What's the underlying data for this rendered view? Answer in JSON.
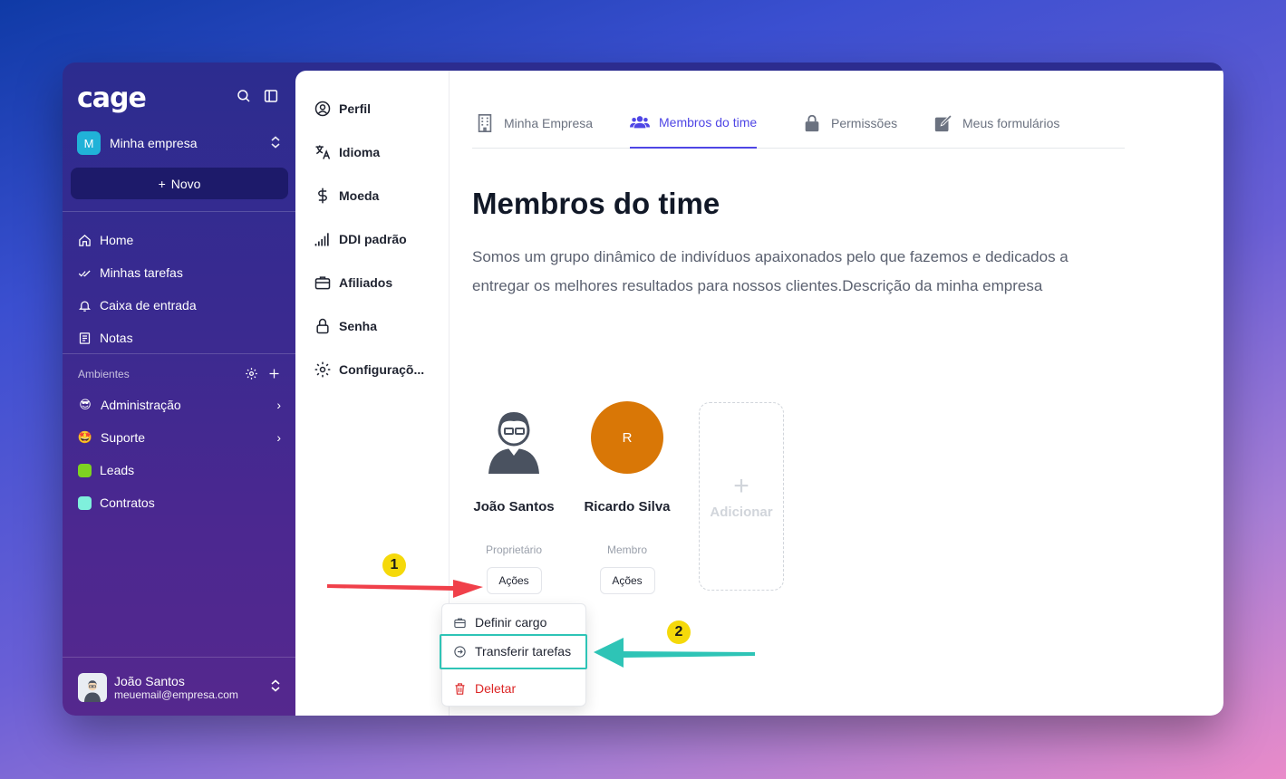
{
  "app": {
    "logo": "cage"
  },
  "workspace": {
    "badge": "M",
    "name": "Minha empresa"
  },
  "new_button": {
    "label": "Novo"
  },
  "nav": [
    {
      "label": "Home",
      "icon": "home-icon"
    },
    {
      "label": "Minhas tarefas",
      "icon": "check-double-icon"
    },
    {
      "label": "Caixa de entrada",
      "icon": "bell-icon"
    },
    {
      "label": "Notas",
      "icon": "notes-icon"
    }
  ],
  "environments": {
    "header": "Ambientes",
    "items": [
      {
        "label": "Administração",
        "emoji": "😎",
        "has_chevron": true
      },
      {
        "label": "Suporte",
        "emoji": "🤩",
        "has_chevron": true
      },
      {
        "label": "Leads",
        "color": "#7ed321"
      },
      {
        "label": "Contratos",
        "color": "#7ff0dc"
      }
    ]
  },
  "user": {
    "name": "João Santos",
    "email": "meuemail@empresa.com"
  },
  "settings_nav": [
    {
      "label": "Perfil",
      "icon": "user-circle-icon"
    },
    {
      "label": "Idioma",
      "icon": "translate-icon"
    },
    {
      "label": "Moeda",
      "icon": "dollar-icon"
    },
    {
      "label": "DDI padrão",
      "icon": "signal-icon"
    },
    {
      "label": "Afiliados",
      "icon": "briefcase-icon"
    },
    {
      "label": "Senha",
      "icon": "lock-icon"
    },
    {
      "label": "Configuraçõ...",
      "icon": "gear-icon"
    }
  ],
  "tabs": [
    {
      "label": "Minha Empresa",
      "icon": "building-icon",
      "active": false
    },
    {
      "label": "Membros do time",
      "icon": "users-icon",
      "active": true
    },
    {
      "label": "Permissões",
      "icon": "lock-icon",
      "active": false
    },
    {
      "label": "Meus formulários",
      "icon": "edit-icon",
      "active": false
    }
  ],
  "page": {
    "title": "Membros do time",
    "description": "Somos um grupo dinâmico de indivíduos apaixonados pelo que fazemos e dedicados a entregar os melhores resultados para nossos clientes.Descrição da minha empresa"
  },
  "members": [
    {
      "name": "João Santos",
      "role": "Proprietário",
      "action": "Ações",
      "avatar": "person-avatar"
    },
    {
      "name": "Ricardo Silva",
      "role": "Membro",
      "action": "Ações",
      "initial": "R",
      "color": "#d97706"
    }
  ],
  "add_card": {
    "label": "Adicionar"
  },
  "dropdown": [
    {
      "label": "Definir cargo",
      "icon": "briefcase-icon"
    },
    {
      "label": "Transferir tarefas",
      "icon": "arrow-circle-right-icon"
    },
    {
      "label": "Deletar",
      "icon": "trash-icon",
      "danger": true
    }
  ],
  "annotations": [
    {
      "number": "1",
      "color": "#f5d90a",
      "arrow_color": "#f0404a"
    },
    {
      "number": "2",
      "color": "#f5d90a",
      "arrow_color": "#2ec4b6"
    }
  ]
}
